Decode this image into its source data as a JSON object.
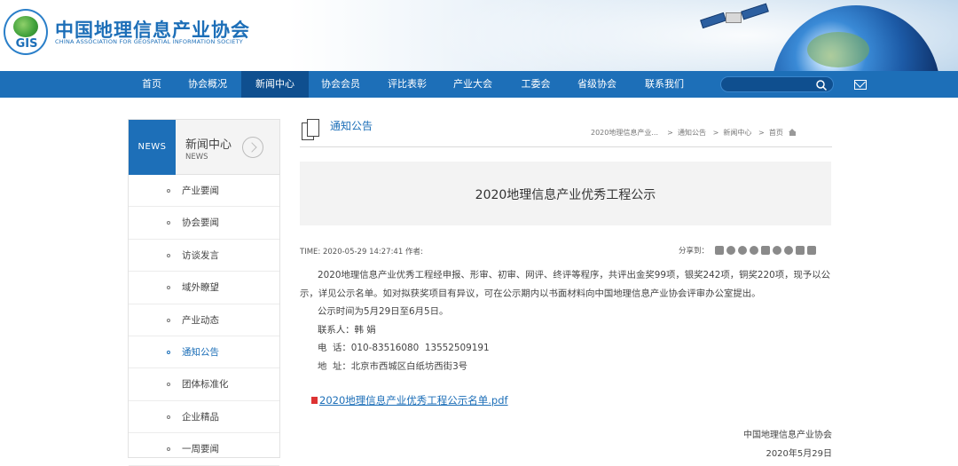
{
  "header": {
    "logo_badge": "GIS",
    "org_name_cn": "中国地理信息产业协会",
    "org_name_en": "CHINA ASSOCIATION FOR GEOSPATIAL INFORMATION SOCIETY"
  },
  "nav": {
    "items": [
      "首页",
      "协会概况",
      "新闻中心",
      "协会会员",
      "评比表彰",
      "产业大会",
      "工委会",
      "省级协会",
      "联系我们"
    ],
    "active": "新闻中心",
    "search_icon": "search-icon",
    "mail_icon": "mail-icon"
  },
  "sidebar": {
    "badge": "NEWS",
    "title": "新闻中心",
    "subtitle": "NEWS",
    "items": [
      "产业要闻",
      "协会要闻",
      "访谈发言",
      "域外瞭望",
      "产业动态",
      "通知公告",
      "团体标准化",
      "企业精品",
      "一周要闻"
    ],
    "active": "通知公告"
  },
  "section": {
    "title": "通知公告",
    "breadcrumb": [
      "2020地理信息产业...",
      ">",
      "通知公告",
      ">",
      "新闻中心",
      ">",
      "首页"
    ]
  },
  "article": {
    "title": "2020地理信息产业优秀工程公示",
    "meta": "TIME: 2020-05-29 14:27:41 作者:",
    "share_label": "分享到：",
    "paragraphs": [
      "2020地理信息产业优秀工程经申报、形审、初审、网评、终评等程序，共评出金奖99项，银奖242项，铜奖220项，现予以公示，详见公示名单。如对拟获奖项目有异议，可在公示期内以书面材料向中国地理信息产业协会评审办公室提出。",
      "公示时间为5月29日至6月5日。",
      "联系人：韩 娟",
      "电  话：010-83516080  13552509191",
      "地  址：北京市西城区白纸坊西街3号"
    ],
    "attachment": "2020地理信息产业优秀工程公示名单.pdf",
    "signoff_org": "中国地理信息产业协会",
    "signoff_date": "2020年5月29日"
  }
}
